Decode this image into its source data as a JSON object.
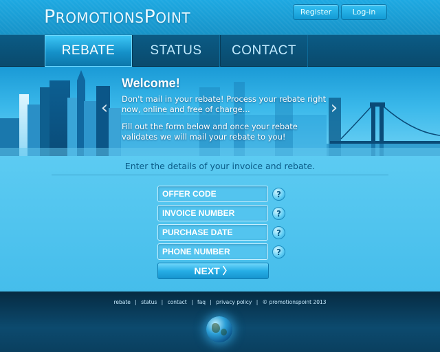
{
  "header": {
    "logo": {
      "first_initial": "P",
      "first_rest": "ROMOTIONS",
      "second_initial": "P",
      "second_rest": "OINT"
    },
    "register_label": "Register",
    "login_label": "Log-in"
  },
  "nav": {
    "items": [
      {
        "label": "REBATE",
        "active": true
      },
      {
        "label": "STATUS",
        "active": false
      },
      {
        "label": "CONTACT",
        "active": false
      }
    ]
  },
  "banner": {
    "title": "Welcome!",
    "paragraph1": "Don't mail in your rebate! Process your rebate right now, online and free of charge...",
    "paragraph2": "Fill out the form below and once your rebate validates we will mail your rebate to you!",
    "prev_icon": "chevron-left-icon",
    "next_icon": "chevron-right-icon"
  },
  "form": {
    "instructions": "Enter the details of your invoice and rebate.",
    "fields": [
      {
        "placeholder": "OFFER CODE"
      },
      {
        "placeholder": "INVOICE NUMBER"
      },
      {
        "placeholder": "PURCHASE DATE"
      },
      {
        "placeholder": "PHONE NUMBER"
      }
    ],
    "help_symbol": "?",
    "next_label": "NEXT",
    "next_arrow": "〉"
  },
  "footer": {
    "links": [
      "rebate",
      "status",
      "contact",
      "faq",
      "privacy policy"
    ],
    "separator": "|",
    "copyright": "© promotionspoint 2013"
  },
  "colors": {
    "accent": "#1ea9e2",
    "nav_bg": "#0b5b85",
    "form_bg": "#5ccbf2",
    "footer_bg": "#062b42"
  }
}
